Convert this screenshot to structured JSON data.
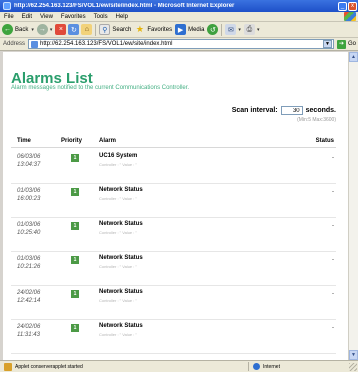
{
  "window": {
    "title": "http://62.254.163.123/FS/VOL1/ew/site/index.html - Microsoft Internet Explorer",
    "minimize": "_",
    "close": "x"
  },
  "menu": [
    "File",
    "Edit",
    "View",
    "Favorites",
    "Tools",
    "Help"
  ],
  "toolbar": {
    "back": "Back",
    "search": "Search",
    "favorites": "Favorites",
    "media": "Media"
  },
  "address": {
    "label": "Address",
    "url": "http://62.254.163.123/FS/VOL1/ew/site/index.html",
    "go": "Go"
  },
  "page": {
    "title": "Alarms List",
    "subtitle": "Alarm messages notified to the current Communications Controller.",
    "scan_label": "Scan interval:",
    "scan_value": "30",
    "scan_unit": "seconds.",
    "scan_hint": "(Min:5 Max:3600)",
    "columns": {
      "time": "Time",
      "priority": "Priority",
      "alarm": "Alarm",
      "status": "Status"
    }
  },
  "alarms": [
    {
      "date": "06/03/06",
      "time": "13:04:37",
      "priority": "1",
      "name": "UC16 System",
      "detail": "Controller : \" Value : \"",
      "status": "-"
    },
    {
      "date": "01/03/06",
      "time": "16:00:23",
      "priority": "1",
      "name": "Network Status",
      "detail": "Controller : \" Value : \"",
      "status": "-"
    },
    {
      "date": "01/03/06",
      "time": "10:25:40",
      "priority": "1",
      "name": "Network Status",
      "detail": "Controller : \" Value : \"",
      "status": "-"
    },
    {
      "date": "01/03/06",
      "time": "10:21:26",
      "priority": "1",
      "name": "Network Status",
      "detail": "Controller : \" Value : \"",
      "status": "-"
    },
    {
      "date": "24/02/06",
      "time": "12:42:14",
      "priority": "1",
      "name": "Network Status",
      "detail": "Controller : \" Value : \"",
      "status": "-"
    },
    {
      "date": "24/02/06",
      "time": "11:31:43",
      "priority": "1",
      "name": "Network Status",
      "detail": "Controller : \" Value : \"",
      "status": "-"
    }
  ],
  "statusbar": {
    "text": "Applet conserverapplet started",
    "zone": "Internet"
  }
}
